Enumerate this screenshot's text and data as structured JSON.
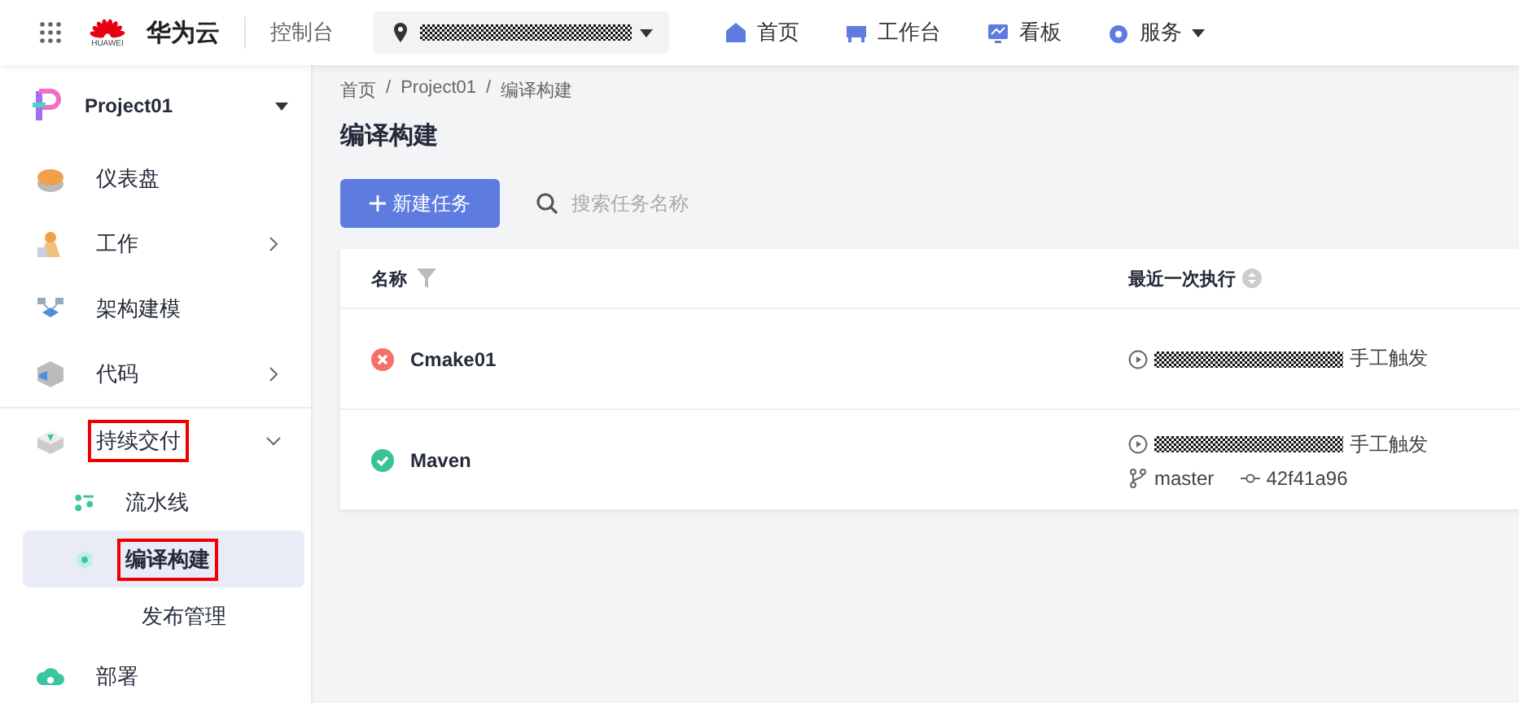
{
  "topbar": {
    "brand": "华为云",
    "logo_caption": "HUAWEI",
    "console": "控制台",
    "nav": [
      {
        "label": "首页",
        "dropdown": false
      },
      {
        "label": "工作台",
        "dropdown": false
      },
      {
        "label": "看板",
        "dropdown": false
      },
      {
        "label": "服务",
        "dropdown": true
      }
    ]
  },
  "sidebar": {
    "project": "Project01",
    "items": [
      {
        "label": "仪表盘",
        "selected": false,
        "highlighted": false
      },
      {
        "label": "工作",
        "expanded": false,
        "selected": false,
        "highlighted": false
      },
      {
        "label": "架构建模",
        "selected": false,
        "highlighted": false
      },
      {
        "label": "代码",
        "expanded": false,
        "selected": false,
        "highlighted": false
      },
      {
        "label": "持续交付",
        "expanded": true,
        "selected": false,
        "highlighted": true,
        "children": [
          {
            "label": "流水线",
            "selected": false,
            "highlighted": false
          },
          {
            "label": "编译构建",
            "selected": true,
            "highlighted": true
          },
          {
            "label": "发布管理",
            "selected": false,
            "highlighted": false
          }
        ]
      },
      {
        "label": "部署",
        "selected": false,
        "highlighted": false
      }
    ]
  },
  "breadcrumb": {
    "separator": "/",
    "items": [
      "首页",
      "Project01",
      "编译构建"
    ]
  },
  "title": "编译构建",
  "toolbar": {
    "new_button": "新建任务",
    "search": {
      "placeholder": "搜索任务名称"
    }
  },
  "table": {
    "columns": [
      {
        "label": "名称"
      },
      {
        "label": "最近一次执行"
      }
    ],
    "rows": [
      {
        "name": "Cmake01",
        "kind": "failed",
        "trigger": "手工触发"
      },
      {
        "name": "Maven",
        "kind": "success",
        "trigger": "手工触发",
        "branch": "master",
        "commit": "42f41a96"
      }
    ]
  }
}
